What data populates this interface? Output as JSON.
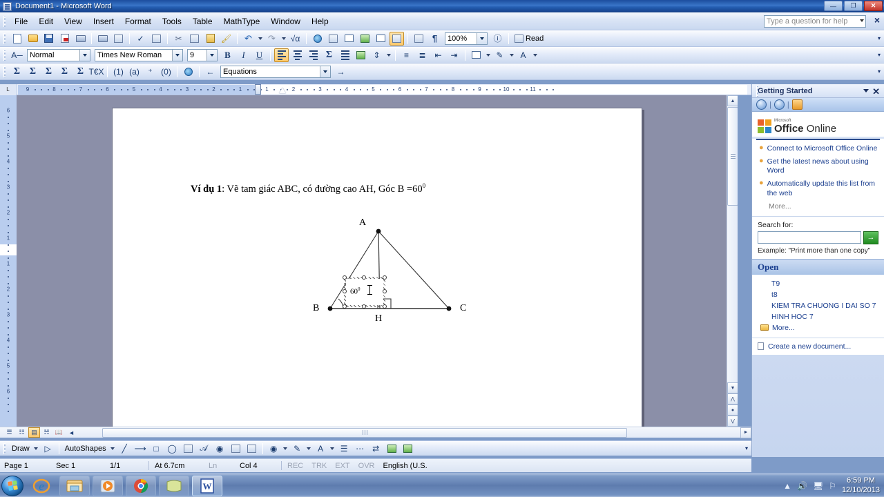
{
  "window": {
    "title": "Document1 - Microsoft Word",
    "minimize": "—",
    "maximize": "❐",
    "close": "✕"
  },
  "menubar": {
    "items": [
      {
        "label": "File"
      },
      {
        "label": "Edit"
      },
      {
        "label": "View"
      },
      {
        "label": "Insert"
      },
      {
        "label": "Format"
      },
      {
        "label": "Tools"
      },
      {
        "label": "Table"
      },
      {
        "label": "MathType"
      },
      {
        "label": "Window"
      },
      {
        "label": "Help"
      }
    ],
    "help_placeholder": "Type a question for help",
    "close_label": "×"
  },
  "toolbars": {
    "standard": {
      "zoom_value": "100%",
      "read_label": "Read"
    },
    "formatting": {
      "style_value": "Normal",
      "font_value": "Times New Roman",
      "size_value": "9",
      "bold": "B",
      "italic": "I",
      "underline": "U"
    },
    "mathtype": {
      "equations_value": "Equations"
    }
  },
  "ruler": {
    "horizontal_numbers": [
      "9",
      "8",
      "7",
      "6",
      "5",
      "4",
      "3",
      "2",
      "1",
      "1",
      "2",
      "3",
      "4",
      "5",
      "6",
      "7",
      "8",
      "9",
      "10",
      "11"
    ],
    "vertical_numbers": [
      "6",
      "5",
      "4",
      "3",
      "2",
      "1",
      "1",
      "2",
      "3",
      "4",
      "5",
      "6"
    ],
    "corner_label": "L"
  },
  "document": {
    "text_prefix": "Ví dụ 1",
    "text_body": ": Vẽ tam giác ABC, có đường cao AH, Góc B =60",
    "text_superscript": "0",
    "figure": {
      "vertex_a": "A",
      "vertex_b": "B",
      "vertex_c": "C",
      "foot_h": "H",
      "angle_label": "60",
      "angle_superscript": "0"
    }
  },
  "taskpane": {
    "title": "Getting Started",
    "dropdown": "▼",
    "close": "✕",
    "nav_back": "◀",
    "nav_forward": "▶",
    "nav_home": "⌂",
    "logo_ms": "Microsoft",
    "logo_office": "Office",
    "logo_online": "Online",
    "links": [
      "Connect to Microsoft Office Online",
      "Get the latest news about using Word",
      "Automatically update this list from the web"
    ],
    "more_label": "More...",
    "search_label": "Search for:",
    "search_value": "",
    "search_placeholder": "",
    "go_label": "→",
    "example_label": "Example:  \"Print more than one copy\"",
    "open_header": "Open",
    "open_items": [
      "T9",
      "t8",
      "KIEM TRA CHUONG I DAI SO 7",
      "HINH HOC 7"
    ],
    "open_more": "More...",
    "create_new": "Create a new document..."
  },
  "drawing_toolbar": {
    "draw_label": "Draw",
    "autoshapes_label": "AutoShapes"
  },
  "statusbar": {
    "page": "Page 1",
    "section": "Sec 1",
    "pages": "1/1",
    "at": "At  6.7cm",
    "line": "Ln",
    "column": "Col 4",
    "rec": "REC",
    "trk": "TRK",
    "ext": "EXT",
    "ovr": "OVR",
    "language": "English (U.S."
  },
  "taskbar": {
    "items": [
      {
        "name": "internet-explorer"
      },
      {
        "name": "windows-explorer"
      },
      {
        "name": "media-player"
      },
      {
        "name": "google-chrome"
      },
      {
        "name": "notes-app"
      },
      {
        "name": "microsoft-word"
      }
    ],
    "clock_time": "6:59 PM",
    "clock_date": "12/10/2013"
  },
  "colors": {
    "titlebar": "#2660b4",
    "accent_orange": "#ffc96b",
    "link_blue": "#1b3f8f"
  }
}
